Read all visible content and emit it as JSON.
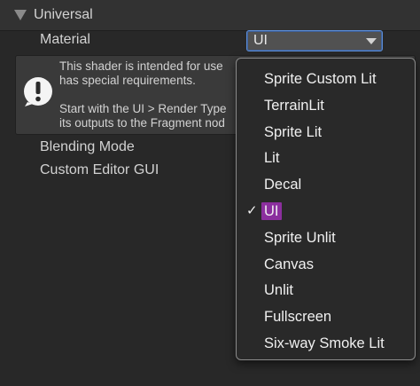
{
  "section": {
    "title": "Universal"
  },
  "material": {
    "label": "Material",
    "value": "UI"
  },
  "help_box": {
    "line1": "This shader is intended for use",
    "line2": "has special requirements.",
    "line3": "Start with the UI > Render Type",
    "line4": "its outputs to the Fragment nod"
  },
  "properties": {
    "blending_mode_label": "Blending Mode",
    "custom_editor_gui_label": "Custom Editor GUI"
  },
  "dropdown": {
    "items": [
      "Sprite Custom Lit",
      "TerrainLit",
      "Sprite Lit",
      "Lit",
      "Decal",
      "UI",
      "Sprite Unlit",
      "Canvas",
      "Unlit",
      "Fullscreen",
      "Six-way Smoke Lit"
    ],
    "selected_index": 5,
    "checkmark": "✓"
  },
  "colors": {
    "selection_highlight": "#8b2f9e",
    "focus_border": "#5c8ed8",
    "panel_background": "#282828"
  }
}
